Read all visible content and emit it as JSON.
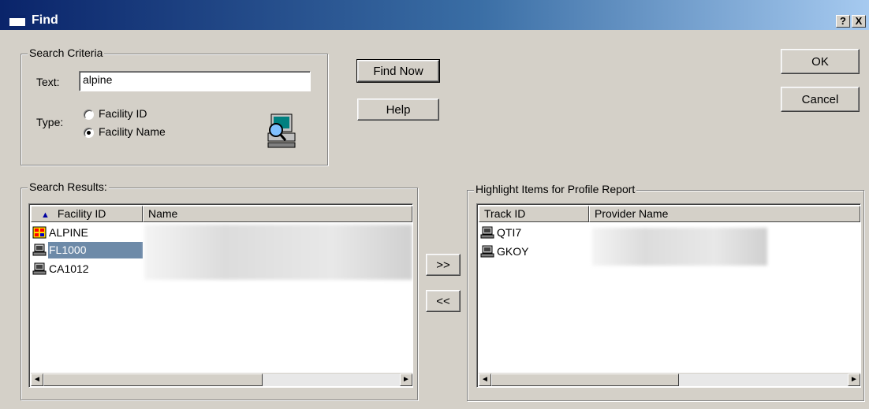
{
  "window": {
    "title": "Find",
    "help_glyph": "?",
    "close_glyph": "X"
  },
  "search_criteria": {
    "group_label": "Search Criteria",
    "text_label": "Text:",
    "text_value": "alpine",
    "type_label": "Type:",
    "options": [
      {
        "label": "Facility ID",
        "selected": false
      },
      {
        "label": "Facility Name",
        "selected": true
      }
    ]
  },
  "buttons": {
    "find_now": "Find Now",
    "help": "Help",
    "ok": "OK",
    "cancel": "Cancel",
    "add": ">>",
    "remove": "<<"
  },
  "search_results": {
    "group_label": "Search Results:",
    "columns": [
      "Facility ID",
      "Name"
    ],
    "sort_indicator": "▲",
    "rows": [
      {
        "id": "ALPINE",
        "icon": "red-facility-icon",
        "selected": false
      },
      {
        "id": "FL1000",
        "icon": "computer-facility-icon",
        "selected": true
      },
      {
        "id": "CA1012",
        "icon": "computer-facility-icon",
        "selected": false
      }
    ]
  },
  "highlight_items": {
    "group_label": "Highlight Items for Profile Report",
    "columns": [
      "Track ID",
      "Provider Name"
    ],
    "rows": [
      {
        "id": "QTI7",
        "icon": "computer-facility-icon"
      },
      {
        "id": "GKOY",
        "icon": "computer-facility-icon"
      }
    ]
  },
  "scroll": {
    "left_arrow": "◄",
    "right_arrow": "►"
  }
}
